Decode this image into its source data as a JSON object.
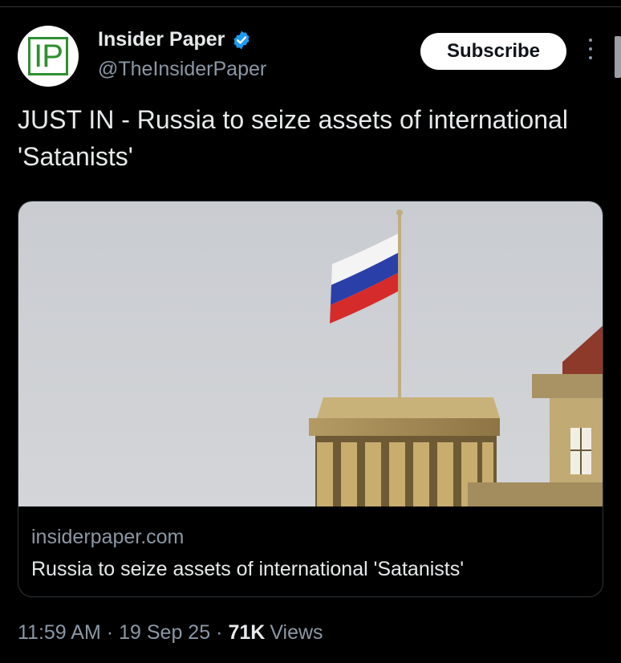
{
  "author": {
    "logo_text": "IP",
    "name": "Insider Paper",
    "handle": "@TheInsiderPaper",
    "verified_icon": "verified-badge-icon"
  },
  "actions": {
    "subscribe_label": "Subscribe",
    "more_icon": "more-vertical-icon"
  },
  "tweet": {
    "text": "JUST IN - Russia to seize assets of international 'Satanists'"
  },
  "card": {
    "domain": "insiderpaper.com",
    "title": "Russia to seize assets of international 'Satanists'"
  },
  "meta": {
    "time": "11:59 AM",
    "separator": "·",
    "date": "19 Sep 25",
    "views_count": "71K",
    "views_label": "Views"
  },
  "colors": {
    "background": "#000000",
    "text": "#e7e9ea",
    "secondary": "#8b98a5",
    "verified": "#1d9bf0",
    "logo": "#2f8f2f"
  }
}
